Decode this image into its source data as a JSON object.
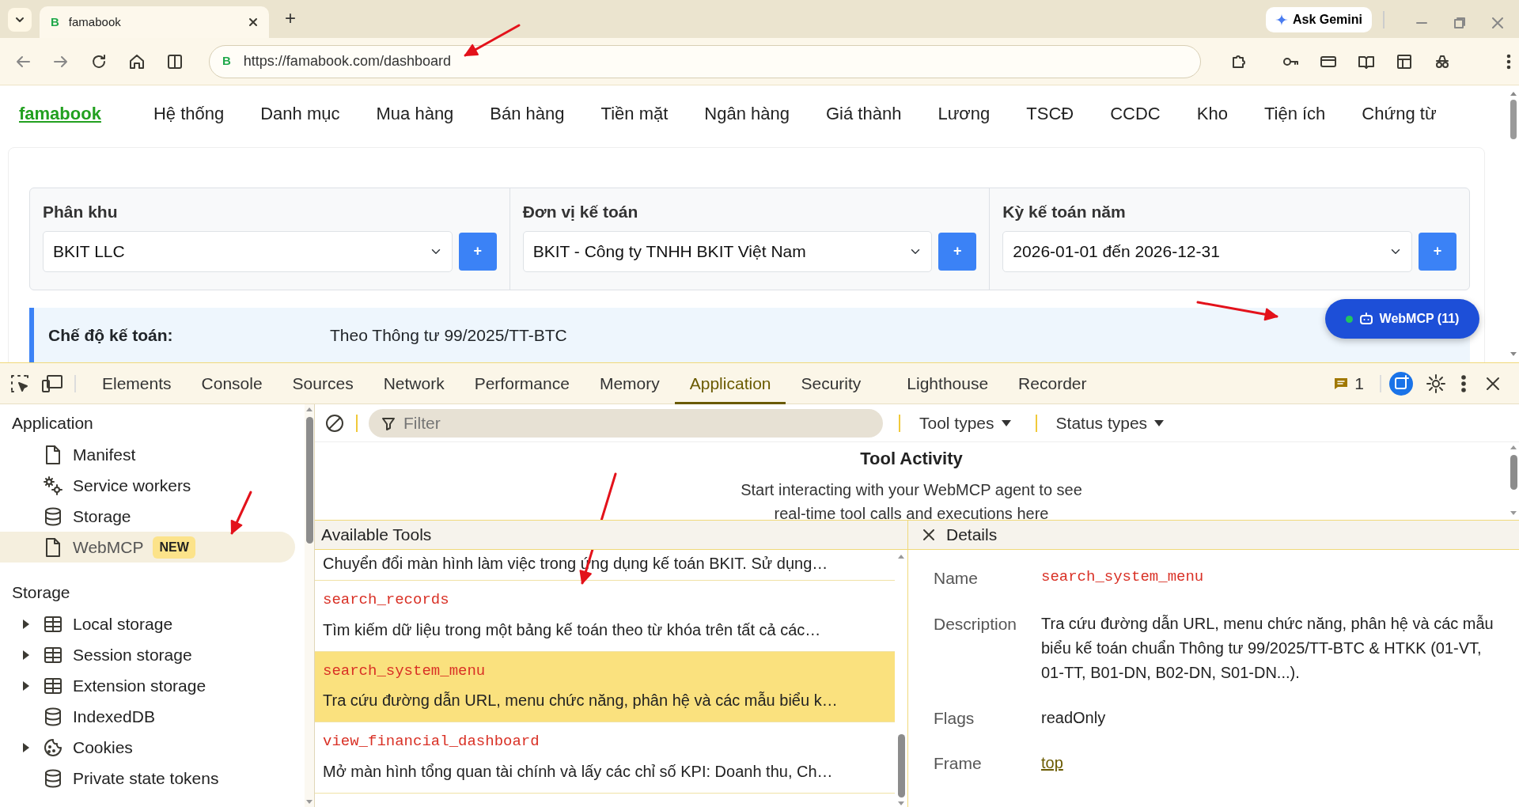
{
  "browser": {
    "tabs": [
      {
        "title": "famabook",
        "favicon": "B",
        "selected": true
      }
    ],
    "new_tab": "+",
    "ask_gemini": "Ask Gemini",
    "address": {
      "favicon": "B",
      "url": "https://famabook.com/dashboard"
    }
  },
  "page": {
    "brand": "famabook",
    "nav": [
      "Hệ thống",
      "Danh mục",
      "Mua hàng",
      "Bán hàng",
      "Tiền mặt",
      "Ngân hàng",
      "Giá thành",
      "Lương",
      "TSCĐ",
      "CCDC",
      "Kho",
      "Tiện ích",
      "Chứng từ"
    ],
    "selectors": [
      {
        "label": "Phân khu",
        "value": "BKIT LLC",
        "add": "+"
      },
      {
        "label": "Đơn vị kế toán",
        "value": "BKIT - Công ty TNHH BKIT Việt Nam",
        "add": "+"
      },
      {
        "label": "Kỳ kế toán năm",
        "value": "2026-01-01 đến 2026-12-31",
        "add": "+"
      }
    ],
    "info": {
      "label": "Chế độ kế toán:",
      "value": "Theo Thông tư 99/2025/TT-BTC"
    },
    "webmcp_button": {
      "label": "WebMCP (11)",
      "connected": true
    }
  },
  "devtools": {
    "tabs": [
      {
        "label": "Elements",
        "selected": false
      },
      {
        "label": "Console",
        "selected": false
      },
      {
        "label": "Sources",
        "selected": false
      },
      {
        "label": "Network",
        "selected": false
      },
      {
        "label": "Performance",
        "selected": false
      },
      {
        "label": "Memory",
        "selected": false
      },
      {
        "label": "Application",
        "selected": true
      },
      {
        "label": "Security",
        "selected": false
      },
      {
        "label": "Lighthouse",
        "selected": false
      },
      {
        "label": "Recorder",
        "selected": false
      }
    ],
    "issues_count": "1",
    "sidebar": [
      {
        "heading": "Application",
        "items": [
          {
            "label": "Manifest",
            "kind": "file",
            "expandable": false,
            "selected": false
          },
          {
            "label": "Service workers",
            "kind": "gears",
            "expandable": false,
            "selected": false
          },
          {
            "label": "Storage",
            "kind": "database",
            "expandable": false,
            "selected": false
          },
          {
            "label": "WebMCP",
            "kind": "file",
            "expandable": false,
            "selected": true,
            "badge": "NEW"
          }
        ]
      },
      {
        "heading": "Storage",
        "items": [
          {
            "label": "Local storage",
            "kind": "table",
            "expandable": true,
            "selected": false
          },
          {
            "label": "Session storage",
            "kind": "table",
            "expandable": true,
            "selected": false
          },
          {
            "label": "Extension storage",
            "kind": "table",
            "expandable": true,
            "selected": false
          },
          {
            "label": "IndexedDB",
            "kind": "database",
            "expandable": false,
            "selected": false
          },
          {
            "label": "Cookies",
            "kind": "cookie",
            "expandable": true,
            "selected": false
          },
          {
            "label": "Private state tokens",
            "kind": "database",
            "expandable": false,
            "selected": false
          }
        ]
      }
    ],
    "filter": {
      "placeholder": "Filter"
    },
    "dropdowns": [
      "Tool types",
      "Status types"
    ],
    "activity": {
      "title": "Tool Activity",
      "message": "Start interacting with your WebMCP agent to see real-time tool calls and executions here"
    },
    "tools_header": "Available Tools",
    "tools": [
      {
        "description": "Chuyển đổi màn hình làm việc trong ứng dụng kế toán BKIT. Sử dụng…",
        "selected": false
      },
      {
        "name": "search_records",
        "description": "Tìm kiếm dữ liệu trong một bảng kế toán theo từ khóa trên tất cả các…",
        "selected": false
      },
      {
        "name": "search_system_menu",
        "description": "Tra cứu đường dẫn URL, menu chức năng, phân hệ và các mẫu biểu k…",
        "selected": true
      },
      {
        "name": "view_financial_dashboard",
        "description": "Mở màn hình tổng quan tài chính và lấy các chỉ số KPI: Doanh thu, Ch…",
        "selected": false
      }
    ],
    "details_header": "Details",
    "details": [
      {
        "label": "Name",
        "value": "search_system_menu",
        "kind": "code"
      },
      {
        "label": "Description",
        "value": "Tra cứu đường dẫn URL, menu chức năng, phân hệ và các mẫu biểu kế toán chuẩn Thông tư 99/2025/TT-BTC & HTKK (01-VT, 01-TT, B01-DN, B02-DN, S01-DN...).",
        "kind": "text"
      },
      {
        "label": "Flags",
        "value": "readOnly",
        "kind": "text"
      },
      {
        "label": "Frame",
        "value": "top",
        "kind": "link"
      }
    ]
  },
  "annotation_arrows": [
    {
      "kind": "arrow"
    },
    {
      "kind": "arrow"
    },
    {
      "kind": "arrow"
    },
    {
      "kind": "arrow"
    }
  ]
}
